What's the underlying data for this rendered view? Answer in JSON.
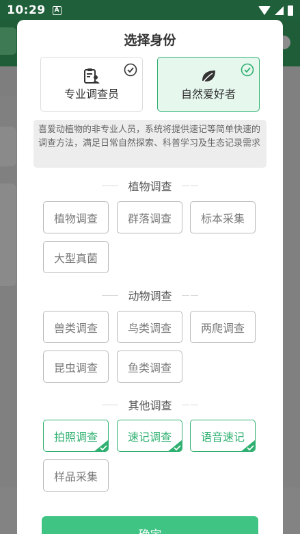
{
  "status_bar": {
    "time": "10:29",
    "notification_icon": "A"
  },
  "dialog": {
    "title": "选择身份",
    "identities": [
      {
        "label": "专业调查员",
        "icon": "clipboard-person-icon",
        "selected": false
      },
      {
        "label": "自然爱好者",
        "icon": "leaf-icon",
        "selected": true
      }
    ],
    "description": "喜爱动植物的非专业人员，系统将提供速记等简单快速的调查方法，满足日常自然探索、科普学习及生态记录需求",
    "sections": [
      {
        "title": "植物调查",
        "tags": [
          {
            "label": "植物调查",
            "selected": false
          },
          {
            "label": "群落调查",
            "selected": false
          },
          {
            "label": "标本采集",
            "selected": false
          },
          {
            "label": "大型真菌",
            "selected": false
          }
        ]
      },
      {
        "title": "动物调查",
        "tags": [
          {
            "label": "兽类调查",
            "selected": false
          },
          {
            "label": "鸟类调查",
            "selected": false
          },
          {
            "label": "两爬调查",
            "selected": false
          },
          {
            "label": "昆虫调查",
            "selected": false
          },
          {
            "label": "鱼类调查",
            "selected": false
          }
        ]
      },
      {
        "title": "其他调查",
        "tags": [
          {
            "label": "拍照调查",
            "selected": true
          },
          {
            "label": "速记调查",
            "selected": true
          },
          {
            "label": "语音速记",
            "selected": true
          },
          {
            "label": "样品采集",
            "selected": false
          }
        ]
      }
    ],
    "confirm_label": "确定"
  },
  "colors": {
    "accent": "#2fb070",
    "button": "#3fc484",
    "selected_bg": "#e6f7ee",
    "header": "#1f5f3a"
  }
}
